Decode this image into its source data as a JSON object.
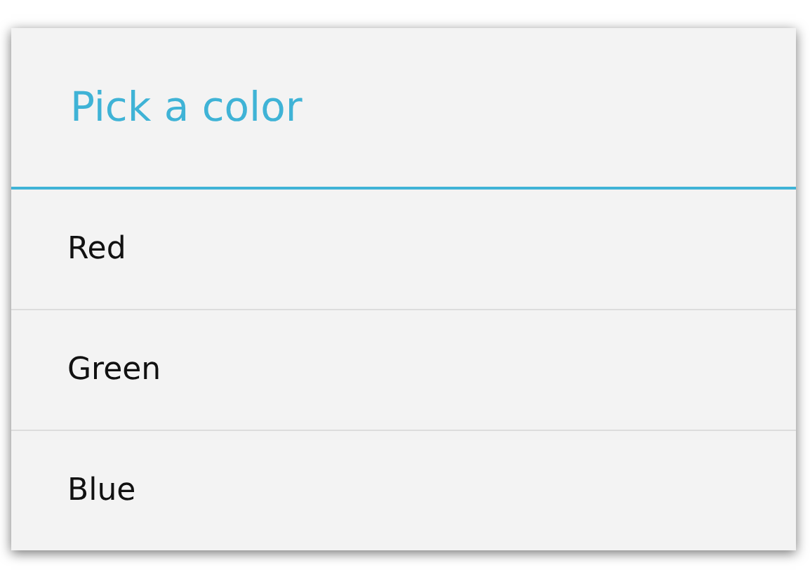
{
  "dialog": {
    "title": "Pick a color",
    "items": [
      {
        "label": "Red"
      },
      {
        "label": "Green"
      },
      {
        "label": "Blue"
      }
    ]
  }
}
